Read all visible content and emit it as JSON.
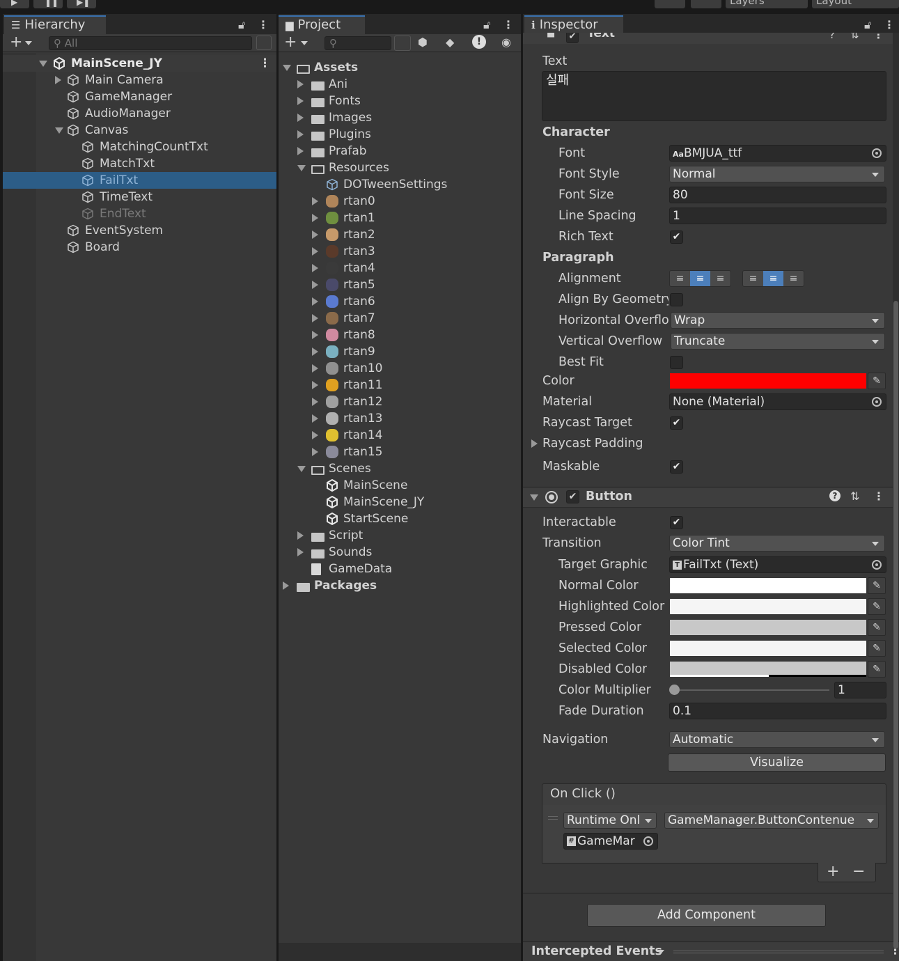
{
  "window": {
    "top_layers": "Layers",
    "top_layout": "Layout"
  },
  "hierarchy": {
    "tab": "Hierarchy",
    "search_placeholder": "All",
    "scene": "MainScene_JY",
    "items": [
      {
        "label": "Main Camera",
        "depth": 1,
        "arrow": "closed",
        "state": "normal"
      },
      {
        "label": "GameManager",
        "depth": 1,
        "arrow": "none",
        "state": "normal"
      },
      {
        "label": "AudioManager",
        "depth": 1,
        "arrow": "none",
        "state": "normal"
      },
      {
        "label": "Canvas",
        "depth": 1,
        "arrow": "open",
        "state": "normal"
      },
      {
        "label": "MatchingCountTxt",
        "depth": 2,
        "arrow": "none",
        "state": "normal"
      },
      {
        "label": "MatchTxt",
        "depth": 2,
        "arrow": "none",
        "state": "normal"
      },
      {
        "label": "FailTxt",
        "depth": 2,
        "arrow": "none",
        "state": "selected"
      },
      {
        "label": "TimeText",
        "depth": 2,
        "arrow": "none",
        "state": "normal"
      },
      {
        "label": "EndText",
        "depth": 2,
        "arrow": "none",
        "state": "disabled"
      },
      {
        "label": "EventSystem",
        "depth": 1,
        "arrow": "none",
        "state": "normal"
      },
      {
        "label": "Board",
        "depth": 1,
        "arrow": "none",
        "state": "normal"
      }
    ]
  },
  "project": {
    "tab": "Project",
    "items": [
      {
        "label": "Assets",
        "depth": 0,
        "arrow": "open",
        "icon": "folder-open",
        "bold": true
      },
      {
        "label": "Ani",
        "depth": 1,
        "arrow": "closed",
        "icon": "folder"
      },
      {
        "label": "Fonts",
        "depth": 1,
        "arrow": "closed",
        "icon": "folder"
      },
      {
        "label": "Images",
        "depth": 1,
        "arrow": "closed",
        "icon": "folder"
      },
      {
        "label": "Plugins",
        "depth": 1,
        "arrow": "closed",
        "icon": "folder"
      },
      {
        "label": "Prafab",
        "depth": 1,
        "arrow": "closed",
        "icon": "folder"
      },
      {
        "label": "Resources",
        "depth": 1,
        "arrow": "open",
        "icon": "folder-open"
      },
      {
        "label": "DOTweenSettings",
        "depth": 2,
        "arrow": "none",
        "icon": "scriptable"
      },
      {
        "label": "rtan0",
        "depth": 2,
        "arrow": "closed",
        "icon": "sprite",
        "color": "#b0855a"
      },
      {
        "label": "rtan1",
        "depth": 2,
        "arrow": "closed",
        "icon": "sprite",
        "color": "#6f8f3f"
      },
      {
        "label": "rtan2",
        "depth": 2,
        "arrow": "closed",
        "icon": "sprite",
        "color": "#c79a6a"
      },
      {
        "label": "rtan3",
        "depth": 2,
        "arrow": "closed",
        "icon": "sprite",
        "color": "#5a3a2a"
      },
      {
        "label": "rtan4",
        "depth": 2,
        "arrow": "closed",
        "icon": "sprite",
        "color": "#3a3a3a"
      },
      {
        "label": "rtan5",
        "depth": 2,
        "arrow": "closed",
        "icon": "sprite",
        "color": "#4a4a6a"
      },
      {
        "label": "rtan6",
        "depth": 2,
        "arrow": "closed",
        "icon": "sprite",
        "color": "#5a7ad0"
      },
      {
        "label": "rtan7",
        "depth": 2,
        "arrow": "closed",
        "icon": "sprite",
        "color": "#8a6a4a"
      },
      {
        "label": "rtan8",
        "depth": 2,
        "arrow": "closed",
        "icon": "sprite",
        "color": "#d08aa0"
      },
      {
        "label": "rtan9",
        "depth": 2,
        "arrow": "closed",
        "icon": "sprite",
        "color": "#7ab0c0"
      },
      {
        "label": "rtan10",
        "depth": 2,
        "arrow": "closed",
        "icon": "sprite",
        "color": "#909090"
      },
      {
        "label": "rtan11",
        "depth": 2,
        "arrow": "closed",
        "icon": "sprite",
        "color": "#e0a020"
      },
      {
        "label": "rtan12",
        "depth": 2,
        "arrow": "closed",
        "icon": "sprite",
        "color": "#a0a0a0"
      },
      {
        "label": "rtan13",
        "depth": 2,
        "arrow": "closed",
        "icon": "sprite",
        "color": "#b0b0b0"
      },
      {
        "label": "rtan14",
        "depth": 2,
        "arrow": "closed",
        "icon": "sprite",
        "color": "#e0c030"
      },
      {
        "label": "rtan15",
        "depth": 2,
        "arrow": "closed",
        "icon": "sprite",
        "color": "#8a8a9a"
      },
      {
        "label": "Scenes",
        "depth": 1,
        "arrow": "open",
        "icon": "folder-open"
      },
      {
        "label": "MainScene",
        "depth": 2,
        "arrow": "none",
        "icon": "scene"
      },
      {
        "label": "MainScene_JY",
        "depth": 2,
        "arrow": "none",
        "icon": "scene"
      },
      {
        "label": "StartScene",
        "depth": 2,
        "arrow": "none",
        "icon": "scene"
      },
      {
        "label": "Script",
        "depth": 1,
        "arrow": "closed",
        "icon": "folder"
      },
      {
        "label": "Sounds",
        "depth": 1,
        "arrow": "closed",
        "icon": "folder"
      },
      {
        "label": "GameData",
        "depth": 1,
        "arrow": "none",
        "icon": "file"
      },
      {
        "label": "Packages",
        "depth": 0,
        "arrow": "closed",
        "icon": "folder",
        "bold": true
      }
    ]
  },
  "inspector": {
    "tab": "Inspector",
    "component_text": "Text",
    "text_label": "Text",
    "text_value": "실패",
    "character_header": "Character",
    "font_label": "Font",
    "font_value": "BMJUA_ttf",
    "font_style_label": "Font Style",
    "font_style_value": "Normal",
    "font_size_label": "Font Size",
    "font_size_value": "80",
    "line_spacing_label": "Line Spacing",
    "line_spacing_value": "1",
    "rich_text_label": "Rich Text",
    "paragraph_header": "Paragraph",
    "alignment_label": "Alignment",
    "align_geometry_label": "Align By Geometry",
    "horizontal_overflow_label": "Horizontal Overflow",
    "horizontal_overflow_value": "Wrap",
    "vertical_overflow_label": "Vertical Overflow",
    "vertical_overflow_value": "Truncate",
    "best_fit_label": "Best Fit",
    "color_label": "Color",
    "material_label": "Material",
    "material_value": "None (Material)",
    "raycast_target_label": "Raycast Target",
    "raycast_padding_label": "Raycast Padding",
    "maskable_label": "Maskable",
    "button_component": "Button",
    "interactable_label": "Interactable",
    "transition_label": "Transition",
    "transition_value": "Color Tint",
    "target_graphic_label": "Target Graphic",
    "target_graphic_value": "FailTxt (Text)",
    "normal_color_label": "Normal Color",
    "highlighted_color_label": "Highlighted Color",
    "pressed_color_label": "Pressed Color",
    "selected_color_label": "Selected Color",
    "disabled_color_label": "Disabled Color",
    "color_multiplier_label": "Color Multiplier",
    "color_multiplier_value": "1",
    "color_multiplier_level": 0,
    "fade_duration_label": "Fade Duration",
    "fade_duration_value": "0.1",
    "navigation_label": "Navigation",
    "navigation_value": "Automatic",
    "visualize_label": "Visualize",
    "onclick_label": "On Click ()",
    "runtime_value": "Runtime Onl",
    "function_value": "GameManager.ButtonContenue",
    "object_value": "GameMar",
    "plus": "+",
    "minus": "−",
    "add_component": "Add Component",
    "intercepted_events": "Intercepted Events",
    "colors": {
      "text_color": "#ff0000",
      "normal": "#ffffff",
      "highlighted": "#f5f5f5",
      "pressed": "#c8c8c8",
      "selected": "#f5f5f5",
      "disabled": "#c8c8c8"
    }
  }
}
